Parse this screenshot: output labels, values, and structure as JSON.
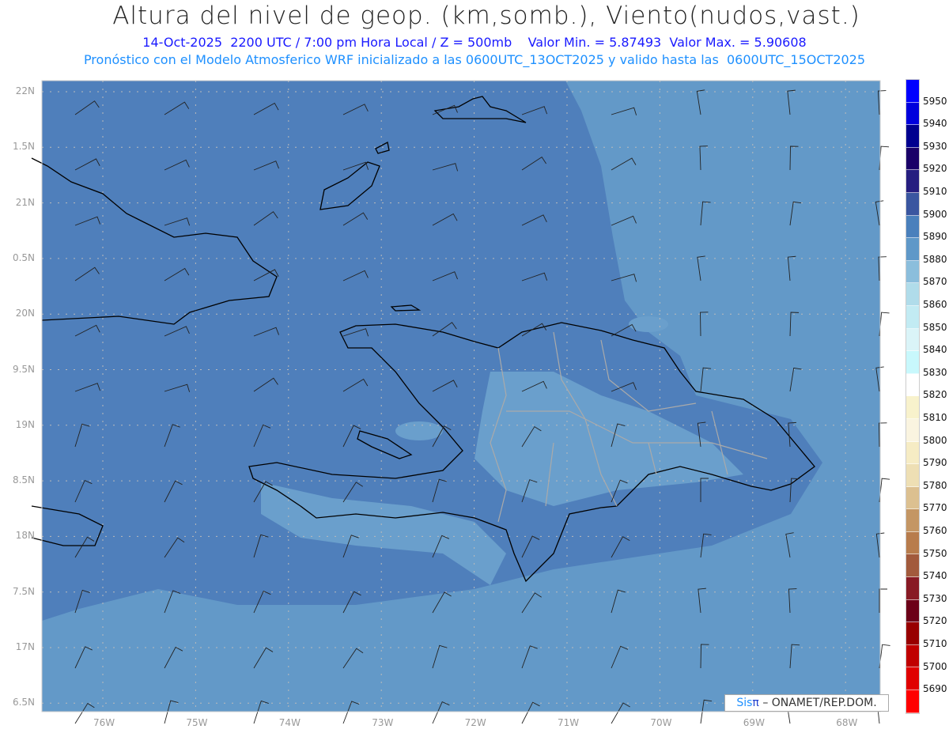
{
  "header": {
    "title": "Altura del nivel de geop. (km,somb.), Viento(nudos,vast.)",
    "line1": "14-Oct-2025  2200 UTC / 7:00 pm Hora Local / Z = 500mb    Valor Min. = 5.87493  Valor Max. = 5.90608",
    "line2": "Pronóstico con el Modelo Atmosferico WRF inicializado a las 0600UTC_13OCT2025 y valido hasta las  0600UTC_15OCT2025"
  },
  "axes": {
    "lon_labels": [
      "76W",
      "75W",
      "74W",
      "73W",
      "72W",
      "71W",
      "70W",
      "69W",
      "68W"
    ],
    "lat_labels": [
      "22N",
      "1.5N",
      "21N",
      "0.5N",
      "20N",
      "9.5N",
      "19N",
      "8.5N",
      "18N",
      "7.5N",
      "17N",
      "6.5N"
    ]
  },
  "colorbar": {
    "labels": [
      "5950",
      "5940",
      "5930",
      "5920",
      "5910",
      "5900",
      "5890",
      "5880",
      "5870",
      "5860",
      "5850",
      "5840",
      "5830",
      "5820",
      "5810",
      "5800",
      "5790",
      "5780",
      "5770",
      "5760",
      "5750",
      "5740",
      "5730",
      "5720",
      "5710",
      "5700",
      "5690"
    ],
    "colors": [
      "#0000ff",
      "#0000dd",
      "#00008f",
      "#1a0068",
      "#261e80",
      "#3a56a0",
      "#4a80bc",
      "#5f98c8",
      "#8bbedc",
      "#b0dcea",
      "#c2ebf3",
      "#daf4f8",
      "#c8f8fc",
      "#ffffff",
      "#f8f2cc",
      "#faf4e0",
      "#f6ecc4",
      "#eedfb4",
      "#dcc090",
      "#c49664",
      "#b87c4c",
      "#a25a3c",
      "#881a24",
      "#6c0018",
      "#980000",
      "#c00000",
      "#e00000",
      "#ff0000"
    ]
  },
  "map_colors": {
    "dark": "#4f7fbb",
    "light": "#6399c8",
    "lighter": "#7aa8d2"
  },
  "logo": {
    "brand": "Sis",
    "pi": "π",
    "text": "– ONAMET/REP.DOM."
  }
}
